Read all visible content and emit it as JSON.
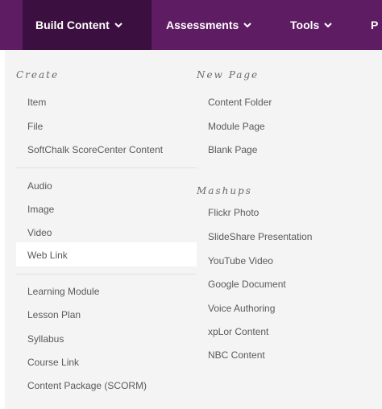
{
  "menubar": {
    "tabs": [
      {
        "label": "Build Content",
        "active": true
      },
      {
        "label": "Assessments"
      },
      {
        "label": "Tools"
      },
      {
        "label": "P"
      }
    ]
  },
  "create": {
    "heading": "Create",
    "group1": [
      "Item",
      "File",
      "SoftChalk ScoreCenter Content"
    ],
    "group2": [
      "Audio",
      "Image",
      "Video",
      "Web Link"
    ],
    "group3": [
      "Learning Module",
      "Lesson Plan",
      "Syllabus",
      "Course Link",
      "Content Package (SCORM)"
    ]
  },
  "new_page": {
    "heading": "New Page",
    "items": [
      "Content Folder",
      "Module Page",
      "Blank Page"
    ]
  },
  "mashups": {
    "heading": "Mashups",
    "items": [
      "Flickr Photo",
      "SlideShare Presentation",
      "YouTube Video",
      "Google Document",
      "Voice Authoring",
      "xpLor Content",
      "NBC Content"
    ]
  },
  "colors": {
    "menubar": "#5e1c62",
    "active_tab": "#3b0f3f",
    "panel": "#f4f4f4",
    "text": "#5a5a5a"
  }
}
